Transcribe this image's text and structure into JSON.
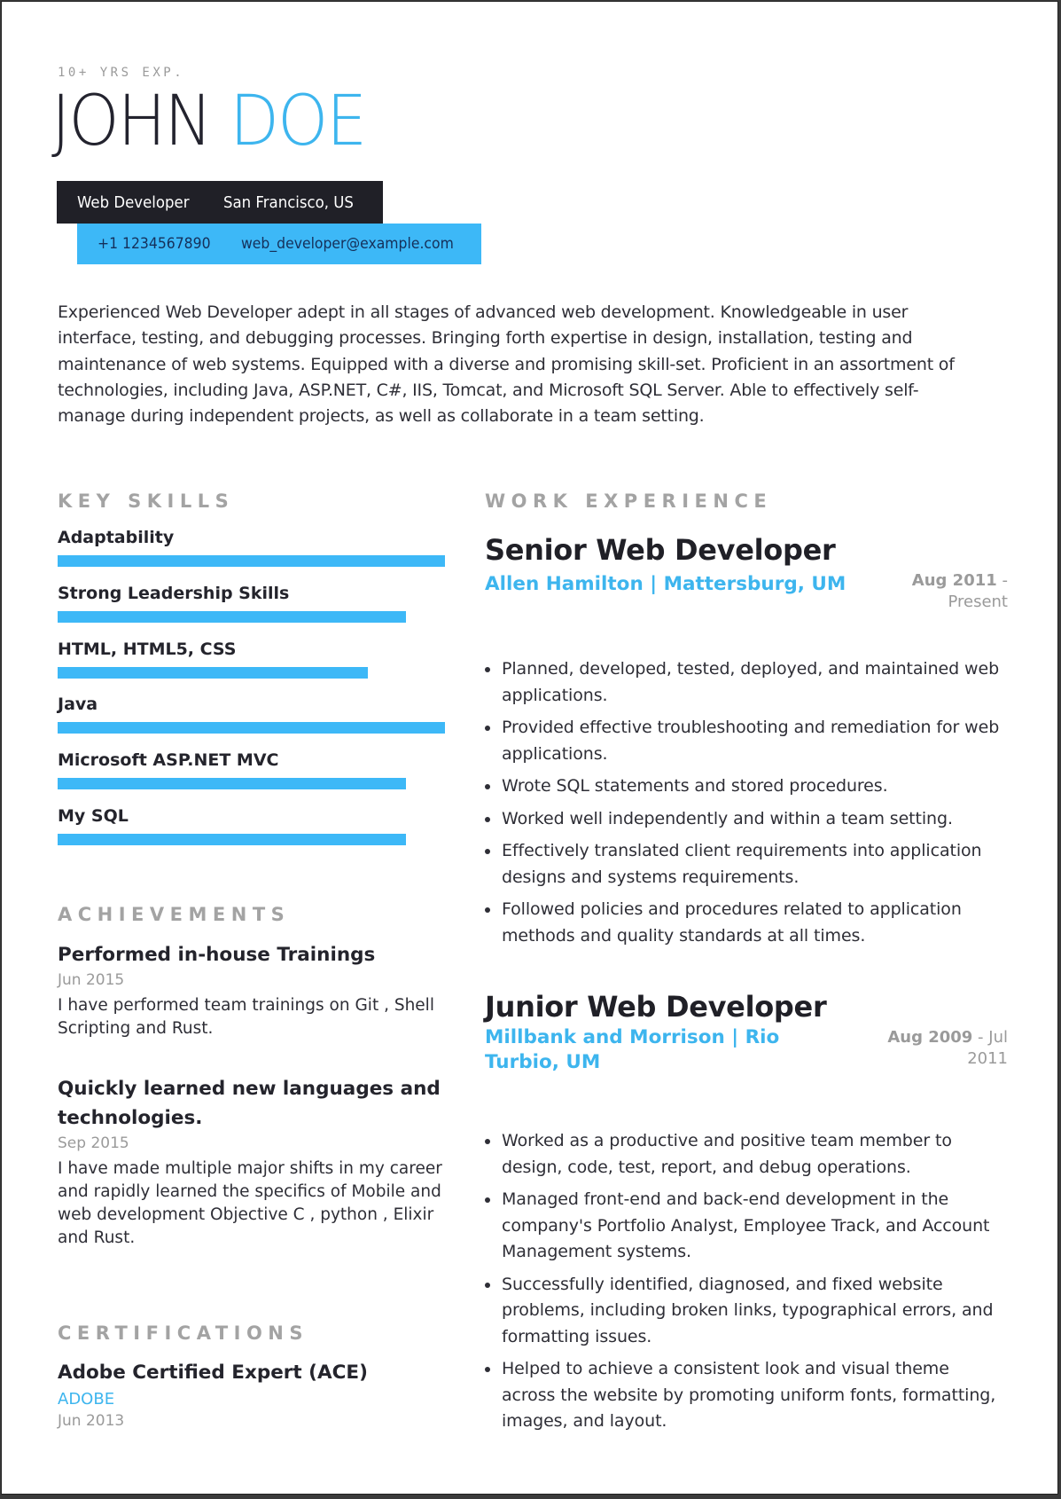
{
  "header": {
    "experience_tag": "10+ YRS EXP.",
    "first_name": "JOHN",
    "last_name": "DOE",
    "role": "Web Developer",
    "location": "San Francisco, US",
    "phone": "+1 1234567890",
    "email": "web_developer@example.com"
  },
  "summary": "Experienced Web Developer adept in all stages of advanced web development. Knowledgeable in user interface, testing, and debugging processes. Bringing forth expertise in design, installation, testing and maintenance of web systems. Equipped with a diverse and promising skill-set. Proficient in an assortment of technologies, including Java, ASP.NET, C#, IIS, Tomcat, and Microsoft SQL Server. Able to effectively self-manage during independent projects, as well as collaborate in a team setting.",
  "skills": {
    "title": "KEY SKILLS",
    "items": [
      {
        "label": "Adaptability",
        "level": 1.0
      },
      {
        "label": "Strong Leadership Skills",
        "level": 0.9
      },
      {
        "label": "HTML, HTML5, CSS",
        "level": 0.8
      },
      {
        "label": "Java",
        "level": 1.0
      },
      {
        "label": "Microsoft ASP.NET MVC",
        "level": 0.9
      },
      {
        "label": "My SQL",
        "level": 0.9
      }
    ]
  },
  "achievements": {
    "title": "ACHIEVEMENTS",
    "items": [
      {
        "title": "Performed in-house Trainings",
        "date": "Jun 2015",
        "description": "I have performed team trainings on Git , Shell Scripting and Rust."
      },
      {
        "title": "Quickly learned new languages and technologies.",
        "date": "Sep 2015",
        "description": "I have made multiple major shifts in my career and rapidly learned the specifics of Mobile and web development Objective C , python , Elixir and Rust."
      }
    ]
  },
  "certifications": {
    "title": "CERTIFICATIONS",
    "items": [
      {
        "title": "Adobe Certified Expert (ACE)",
        "organization": "ADOBE",
        "date": "Jun 2013"
      }
    ]
  },
  "work": {
    "title": "WORK EXPERIENCE",
    "jobs": [
      {
        "title": "Senior Web Developer",
        "company": "Allen Hamilton | Mattersburg, UM",
        "start": "Aug 2011",
        "separator": " - ",
        "end": "Present",
        "bullets": [
          "Planned, developed, tested, deployed, and maintained web applications.",
          "Provided effective troubleshooting and remediation for web applications.",
          "Wrote SQL statements and stored procedures.",
          "Worked well independently and within a team setting.",
          "Effectively translated client requirements into application designs and systems requirements.",
          "Followed policies and procedures related to application methods and quality standards at all times."
        ]
      },
      {
        "title": "Junior Web Developer",
        "company": "Millbank and Morrison | Rio Turbio, UM",
        "start": "Aug 2009",
        "separator": " - ",
        "end": "Jul 2011",
        "bullets": [
          "Worked as a productive and positive team member to design, code, test, report, and debug operations.",
          "Managed front-end and back-end development in the company's Portfolio Analyst, Employee Track, and Account Management systems.",
          "Successfully identified, diagnosed, and fixed website problems, including broken links, typographical errors, and formatting issues.",
          "Helped to achieve a consistent look and visual theme across the website by promoting uniform fonts, formatting, images, and layout."
        ]
      }
    ]
  },
  "colors": {
    "accent": "#3db8f7",
    "dark": "#202027",
    "muted": "#9a9a9a"
  }
}
